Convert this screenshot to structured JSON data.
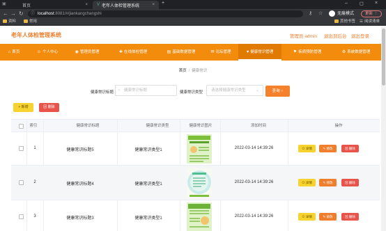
{
  "browser": {
    "tabs": [
      {
        "title": "首页"
      },
      {
        "title": "老年人体检管理系统"
      }
    ],
    "url_host": "localhost",
    "url_rest": ":8081/#/jiankangchangshi",
    "profile_label": "无痕模式",
    "update_label": "更新 ⋮",
    "bookmarks": [
      "资料",
      "常用"
    ],
    "bookmarks_right": [
      "其他书签",
      "阅读清单"
    ]
  },
  "header": {
    "app_title": "老年人体检管理系统",
    "admin_label": "管理员 admin",
    "backend_label": "退出到后台",
    "logout_label": "退出登录"
  },
  "nav": {
    "items": [
      {
        "label": "首页",
        "icon": "home-icon"
      },
      {
        "label": "个人中心",
        "icon": "user-icon"
      },
      {
        "label": "管理员管理",
        "icon": "admin-icon"
      },
      {
        "label": "在线体检管理",
        "icon": "check-icon"
      },
      {
        "label": "基础数据管理",
        "icon": "data-icon"
      },
      {
        "label": "论坛管理",
        "icon": "forum-icon"
      },
      {
        "label": "健康常识管理",
        "icon": "health-icon"
      },
      {
        "label": "疾病预防管理",
        "icon": "prevent-icon"
      },
      {
        "label": "系统数据管理",
        "icon": "system-icon"
      }
    ]
  },
  "breadcrumb": {
    "home": "首页",
    "separator": "/",
    "current": "健康常识"
  },
  "search": {
    "title_label": "健康常识标题",
    "title_placeholder": "健康常识标题",
    "type_label": "健康常识类型",
    "type_placeholder": "请选择健康常识类型",
    "query_label": "查询 ○"
  },
  "toolbar": {
    "add_label": "+ 新增",
    "delete_label": "⊠ 删除"
  },
  "table": {
    "headers": [
      "索引",
      "健康常识标题",
      "健康常识类型",
      "健康常识图片",
      "添加时间",
      "操作"
    ],
    "rows": [
      {
        "index": "1",
        "title": "健康常识标题5",
        "type": "健康常识类型1",
        "time": "2022-03-14 14:39:26"
      },
      {
        "index": "2",
        "title": "健康常识标题4",
        "type": "健康常识类型1",
        "time": "2022-03-14 14:39:26"
      },
      {
        "index": "3",
        "title": "健康常识标题3",
        "type": "健康常识类型1",
        "time": "2022-03-14 14:39:26"
      }
    ],
    "actions": {
      "detail": "⊙ 详情",
      "edit": "✎ 修改",
      "remove": "⊠ 删除"
    }
  },
  "colors": {
    "brand": "#f38b0c",
    "accent": "#f07f2d",
    "danger": "#e8534a",
    "warning": "#f7d32f"
  }
}
